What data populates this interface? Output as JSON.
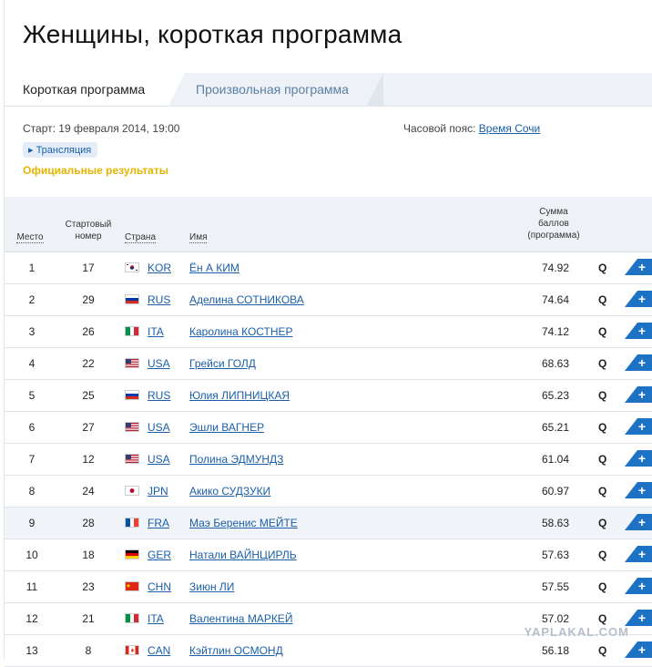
{
  "page": {
    "title": "Женщины, короткая программа"
  },
  "tabs": [
    {
      "label": "Короткая программа",
      "active": true
    },
    {
      "label": "Произвольная программа",
      "active": false
    }
  ],
  "info": {
    "start_label": "Старт: 19 февраля 2014, 19:00",
    "timezone_label": "Часовой пояс:",
    "timezone_value": "Время Сочи",
    "broadcast": "▸ Трансляция",
    "official": "Официальные результаты"
  },
  "table": {
    "headers": {
      "place": "Место",
      "start_line1": "Стартовый",
      "start_line2": "номер",
      "country": "Страна",
      "name": "Имя",
      "score_line1": "Сумма",
      "score_line2": "баллов",
      "score_line3": "(программа)"
    },
    "rows": [
      {
        "place": "1",
        "start": "17",
        "country": "KOR",
        "flag": "kor",
        "name": "Ён А КИМ",
        "score": "74.92",
        "q": "Q",
        "action": "+"
      },
      {
        "place": "2",
        "start": "29",
        "country": "RUS",
        "flag": "rus",
        "name": "Аделина СОТНИКОВА",
        "score": "74.64",
        "q": "Q",
        "action": "+"
      },
      {
        "place": "3",
        "start": "26",
        "country": "ITA",
        "flag": "ita",
        "name": "Каролина КОСТНЕР",
        "score": "74.12",
        "q": "Q",
        "action": "+"
      },
      {
        "place": "4",
        "start": "22",
        "country": "USA",
        "flag": "usa",
        "name": "Грейси ГОЛД",
        "score": "68.63",
        "q": "Q",
        "action": "+"
      },
      {
        "place": "5",
        "start": "25",
        "country": "RUS",
        "flag": "rus",
        "name": "Юлия ЛИПНИЦКАЯ",
        "score": "65.23",
        "q": "Q",
        "action": "+"
      },
      {
        "place": "6",
        "start": "27",
        "country": "USA",
        "flag": "usa",
        "name": "Эшли ВАГНЕР",
        "score": "65.21",
        "q": "Q",
        "action": "+"
      },
      {
        "place": "7",
        "start": "12",
        "country": "USA",
        "flag": "usa",
        "name": "Полина ЭДМУНДЗ",
        "score": "61.04",
        "q": "Q",
        "action": "+"
      },
      {
        "place": "8",
        "start": "24",
        "country": "JPN",
        "flag": "jpn",
        "name": "Акико СУДЗУКИ",
        "score": "60.97",
        "q": "Q",
        "action": "+"
      },
      {
        "place": "9",
        "start": "28",
        "country": "FRA",
        "flag": "fra",
        "name": "Маэ Беренис МЕЙТЕ",
        "score": "58.63",
        "q": "Q",
        "action": "+",
        "highlight": true
      },
      {
        "place": "10",
        "start": "18",
        "country": "GER",
        "flag": "ger",
        "name": "Натали ВАЙНЦИРЛЬ",
        "score": "57.63",
        "q": "Q",
        "action": "+"
      },
      {
        "place": "11",
        "start": "23",
        "country": "CHN",
        "flag": "chn",
        "name": "Зиюн ЛИ",
        "score": "57.55",
        "q": "Q",
        "action": "+"
      },
      {
        "place": "12",
        "start": "21",
        "country": "ITA",
        "flag": "ita",
        "name": "Валентина МАРКЕЙ",
        "score": "57.02",
        "q": "Q",
        "action": "+"
      },
      {
        "place": "13",
        "start": "8",
        "country": "CAN",
        "flag": "can",
        "name": "Кэйтлин ОСМОНД",
        "score": "56.18",
        "q": "Q",
        "action": "+"
      }
    ]
  },
  "watermark": "YAPLAKAL.COM"
}
